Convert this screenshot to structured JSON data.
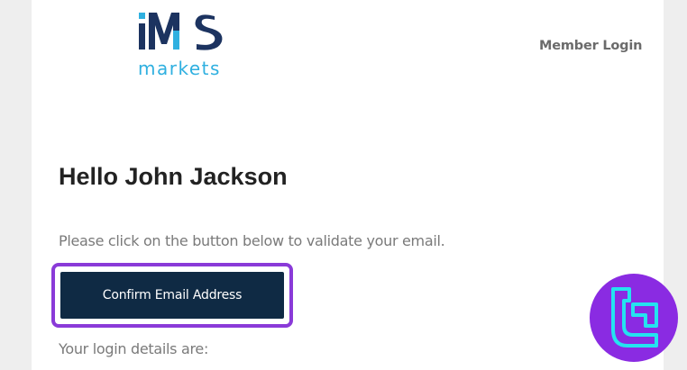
{
  "header": {
    "logo_primary": "IMS",
    "logo_secondary": "markets",
    "member_login": "Member Login"
  },
  "email": {
    "greeting": "Hello John Jackson",
    "instruction": "Please click on the button below to validate your email.",
    "confirm_button": "Confirm Email Address",
    "login_details": "Your login details are:"
  },
  "colors": {
    "button_bg": "#0f2a44",
    "focus_ring": "#8a3ad8",
    "logo_navy": "#1c3360",
    "logo_cyan": "#2fb0e0",
    "badge_bg": "#8a2be2",
    "badge_icon": "#24e3f0"
  },
  "icons": {
    "watermark": "brand-badge-icon"
  }
}
